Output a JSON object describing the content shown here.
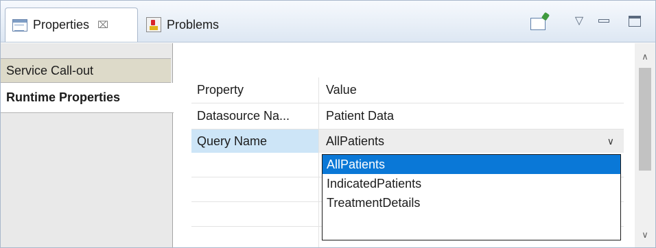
{
  "tabs": [
    {
      "label": "Properties",
      "close": "⌧",
      "active": true
    },
    {
      "label": "Problems",
      "active": false
    }
  ],
  "toolbar": {
    "pin_icon": "pin-to-dashboard-icon",
    "view_menu_icon": "▽",
    "minimize_icon": "minimize-icon",
    "maximize_icon": "maximize-icon"
  },
  "sections": [
    {
      "label": "Service Call-out",
      "selected": false
    },
    {
      "label": "Runtime Properties",
      "selected": true
    }
  ],
  "table": {
    "header": {
      "property": "Property",
      "value": "Value"
    },
    "rows": [
      {
        "property": "Datasource Na...",
        "value": "Patient Data"
      },
      {
        "property": "Query Name",
        "value": "AllPatients"
      }
    ]
  },
  "dropdown": {
    "arrow": "∨",
    "options": [
      "AllPatients",
      "IndicatedPatients",
      "TreatmentDetails"
    ],
    "selected": "AllPatients"
  },
  "scrollbar": {
    "up": "∧",
    "down": "∨"
  },
  "colors": {
    "selection": "#0a78d7",
    "row_highlight": "#cde5f7",
    "tab_gradient_top": "#f6f9fd",
    "tab_gradient_bottom": "#dde7f3"
  }
}
